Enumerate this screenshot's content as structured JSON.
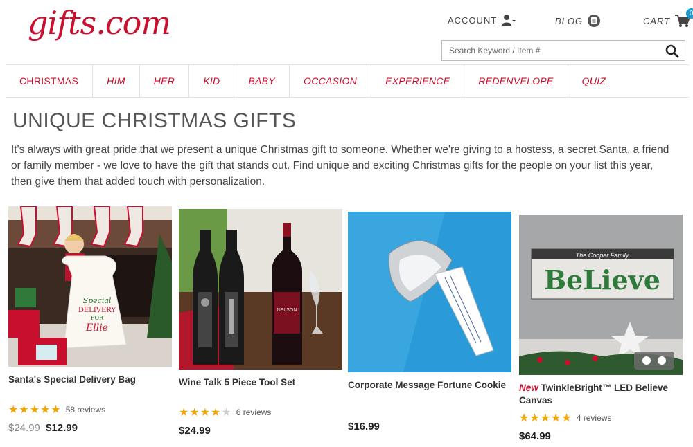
{
  "header": {
    "logo": "gifts.com",
    "account_label": "ACCOUNT",
    "blog_label": "BLOG",
    "cart_label": "CART",
    "cart_count": "0",
    "search_placeholder": "Search Keyword / Item #"
  },
  "nav": [
    {
      "label": "CHRISTMAS"
    },
    {
      "label": "HIM"
    },
    {
      "label": "HER"
    },
    {
      "label": "KID"
    },
    {
      "label": "BABY"
    },
    {
      "label": "OCCASION"
    },
    {
      "label": "EXPERIENCE"
    },
    {
      "label": "REDENVELOPE"
    },
    {
      "label": "QUIZ"
    }
  ],
  "main": {
    "title": "UNIQUE CHRISTMAS GIFTS",
    "intro": "It's always with great pride that we present a unique Christmas gift to someone. Whether we're giving to a hostess, a secret Santa, a friend or family member - we love to have the gift that stands out. Find unique and exciting Christmas gifts for the people on your list this year, then give them that added touch with personalization."
  },
  "products": [
    {
      "name": "Santa's Special Delivery Bag",
      "rating": 5,
      "reviews": "58 reviews",
      "old_price": "$24.99",
      "price": "$12.99"
    },
    {
      "name": "Wine Talk 5 Piece Tool Set",
      "rating": 4.5,
      "reviews": "6 reviews",
      "old_price": "",
      "price": "$24.99"
    },
    {
      "name": "Corporate Message Fortune Cookie",
      "rating": 0,
      "reviews": "",
      "old_price": "",
      "price": "$16.99"
    },
    {
      "badge": "New",
      "name": "TwinkleBright™ LED Believe Canvas",
      "rating": 5,
      "reviews": "4 reviews",
      "old_price": "",
      "price": "$64.99"
    }
  ],
  "colors": {
    "brand": "#c8102e",
    "star": "#f0a500",
    "badge": "#1a9bd7"
  }
}
